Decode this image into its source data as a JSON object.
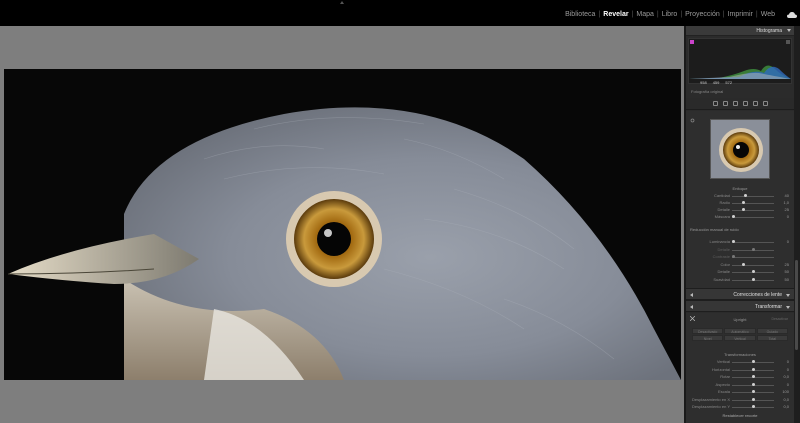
{
  "topbar": {
    "modules": [
      {
        "label": "Biblioteca",
        "active": false
      },
      {
        "label": "Revelar",
        "active": true
      },
      {
        "label": "Mapa",
        "active": false
      },
      {
        "label": "Libro",
        "active": false
      },
      {
        "label": "Proyección",
        "active": false
      },
      {
        "label": "Imprimir",
        "active": false
      },
      {
        "label": "Web",
        "active": false
      }
    ],
    "separator": "|"
  },
  "histogram": {
    "title": "Histograma",
    "values": [
      "958",
      "459",
      "572"
    ],
    "footer": "Fotografía original"
  },
  "detail": {
    "sharpen_title": "Enfoque",
    "sharpen_sliders": [
      {
        "label": "Cantidad",
        "value": "40",
        "level": 0.3
      },
      {
        "label": "Radio",
        "value": "1,0",
        "level": 0.25
      },
      {
        "label": "Detalle",
        "value": "25",
        "level": 0.25
      },
      {
        "label": "Máscara",
        "value": "0",
        "level": 0.0
      }
    ],
    "noise_title": "Reducción manual de ruido",
    "noise_sliders": [
      {
        "label": "Luminancia",
        "value": "0",
        "level": 0.0,
        "dim": false
      },
      {
        "label": "Detalle",
        "value": "",
        "level": 0.5,
        "dim": true
      },
      {
        "label": "Contraste",
        "value": "",
        "level": 0.0,
        "dim": true
      },
      {
        "label": "Color",
        "value": "25",
        "level": 0.25,
        "dim": false
      },
      {
        "label": "Detalle",
        "value": "50",
        "level": 0.5,
        "dim": false
      },
      {
        "label": "Suavidad",
        "value": "50",
        "level": 0.5,
        "dim": false
      }
    ]
  },
  "lens_corrections": {
    "title": "Correcciones de lente"
  },
  "transform": {
    "title": "Transformar",
    "upright_title": "Upright",
    "upright_extra": "Desactivar",
    "upright_buttons": [
      "Desactivado",
      "Automático",
      "Guiado",
      "Nivel",
      "Vertical",
      "Total"
    ],
    "transforms_title": "Transformaciones",
    "sliders": [
      {
        "label": "Vertical",
        "value": "0",
        "level": 0.5
      },
      {
        "label": "Horizontal",
        "value": "0",
        "level": 0.5
      },
      {
        "label": "Rotar",
        "value": "0,0",
        "level": 0.5
      },
      {
        "label": "Aspecto",
        "value": "0",
        "level": 0.5
      },
      {
        "label": "Escala",
        "value": "100",
        "level": 0.5
      },
      {
        "label": "Desplazamiento en X",
        "value": "0,0",
        "level": 0.5
      },
      {
        "label": "Desplazamiento en Y",
        "value": "0,0",
        "level": 0.5
      }
    ],
    "reset": "Restablecer recorte"
  },
  "colors": {
    "canvas_bg": "#7e7e7e",
    "panel_bg": "#2b2b2b",
    "active_module": "#ffffff"
  }
}
